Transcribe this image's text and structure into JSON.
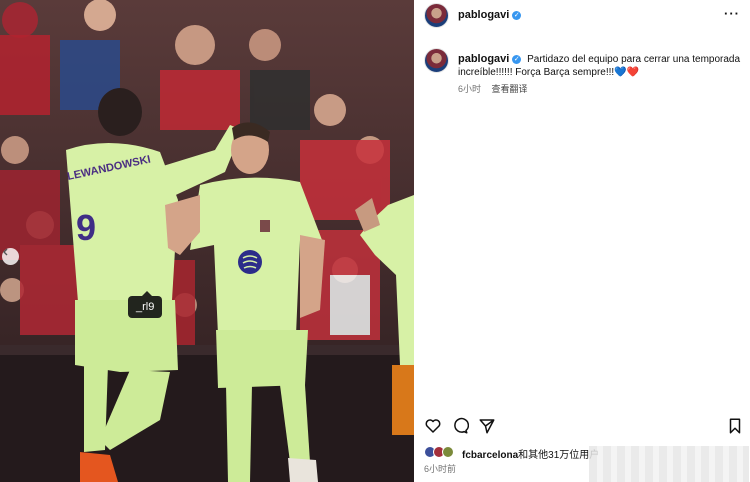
{
  "post": {
    "username": "pablogavi",
    "verified": true,
    "more_icon": "more-horizontal-icon",
    "photo_tag": "_rl9",
    "photo_alt_jersey_name": "LEWANDOWSKI",
    "photo_alt_jersey_number": "9",
    "caption_user": "pablogavi",
    "caption_text": "Partidazo del equipo para cerrar una temporada increíble!!!!!! Força Barça sempre!!!💙❤️",
    "time": "6小时",
    "translate": "查看翻译",
    "likes_user": "fcbarcelona",
    "likes_suffix": "和其他31万位用户",
    "time_ago": "6小时前",
    "icons": [
      "heart-icon",
      "comment-icon",
      "share-icon",
      "bookmark-icon"
    ]
  },
  "colors": {
    "accent_blue": "#3897f0",
    "kit_green": "#d7f1a6",
    "crowd_red": "#b3232f"
  }
}
